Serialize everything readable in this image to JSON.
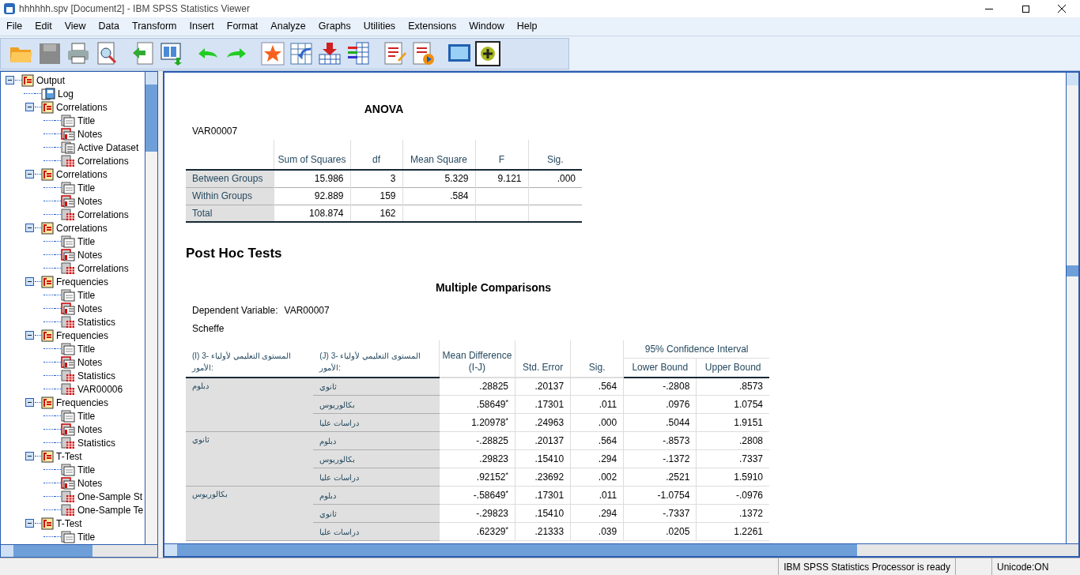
{
  "window": {
    "title": "hhhhhh.spv [Document2] - IBM SPSS Statistics Viewer"
  },
  "menu": [
    "File",
    "Edit",
    "View",
    "Data",
    "Transform",
    "Insert",
    "Format",
    "Analyze",
    "Graphs",
    "Utilities",
    "Extensions",
    "Window",
    "Help"
  ],
  "outline": [
    {
      "label": "Output",
      "kind": "folder",
      "expanded": true,
      "children": [
        {
          "label": "Log",
          "kind": "log"
        },
        {
          "label": "Correlations",
          "kind": "folder",
          "expanded": true,
          "children": [
            {
              "label": "Title",
              "kind": "title"
            },
            {
              "label": "Notes",
              "kind": "notes"
            },
            {
              "label": "Active Dataset",
              "kind": "text"
            },
            {
              "label": "Correlations",
              "kind": "table"
            }
          ]
        },
        {
          "label": "Correlations",
          "kind": "folder",
          "expanded": true,
          "children": [
            {
              "label": "Title",
              "kind": "title"
            },
            {
              "label": "Notes",
              "kind": "notes"
            },
            {
              "label": "Correlations",
              "kind": "table"
            }
          ]
        },
        {
          "label": "Correlations",
          "kind": "folder",
          "expanded": true,
          "children": [
            {
              "label": "Title",
              "kind": "title"
            },
            {
              "label": "Notes",
              "kind": "notes"
            },
            {
              "label": "Correlations",
              "kind": "table"
            }
          ]
        },
        {
          "label": "Frequencies",
          "kind": "folder",
          "expanded": true,
          "children": [
            {
              "label": "Title",
              "kind": "title"
            },
            {
              "label": "Notes",
              "kind": "notes"
            },
            {
              "label": "Statistics",
              "kind": "table"
            }
          ]
        },
        {
          "label": "Frequencies",
          "kind": "folder",
          "expanded": true,
          "children": [
            {
              "label": "Title",
              "kind": "title"
            },
            {
              "label": "Notes",
              "kind": "notes"
            },
            {
              "label": "Statistics",
              "kind": "table"
            },
            {
              "label": "VAR00006",
              "kind": "table"
            }
          ]
        },
        {
          "label": "Frequencies",
          "kind": "folder",
          "expanded": true,
          "children": [
            {
              "label": "Title",
              "kind": "title"
            },
            {
              "label": "Notes",
              "kind": "notes"
            },
            {
              "label": "Statistics",
              "kind": "table"
            }
          ]
        },
        {
          "label": "T-Test",
          "kind": "folder",
          "expanded": true,
          "children": [
            {
              "label": "Title",
              "kind": "title"
            },
            {
              "label": "Notes",
              "kind": "notes"
            },
            {
              "label": "One-Sample St",
              "kind": "table"
            },
            {
              "label": "One-Sample Te",
              "kind": "table"
            }
          ]
        },
        {
          "label": "T-Test",
          "kind": "folder",
          "expanded": true,
          "children": [
            {
              "label": "Title",
              "kind": "title"
            }
          ]
        }
      ]
    }
  ],
  "anova": {
    "title": "ANOVA",
    "variable": "VAR00007",
    "columns": [
      "Sum of Squares",
      "df",
      "Mean Square",
      "F",
      "Sig."
    ],
    "rows": [
      {
        "label": "Between Groups",
        "cells": [
          "15.986",
          "3",
          "5.329",
          "9.121",
          ".000"
        ]
      },
      {
        "label": "Within Groups",
        "cells": [
          "92.889",
          "159",
          ".584",
          "",
          ""
        ]
      },
      {
        "label": "Total",
        "cells": [
          "108.874",
          "162",
          "",
          "",
          ""
        ]
      }
    ]
  },
  "post_hoc_heading": "Post Hoc Tests",
  "comparisons": {
    "title": "Multiple Comparisons",
    "dependent_label": "Dependent Variable:",
    "dependent_value": "VAR00007",
    "method": "Scheffe",
    "ci_header": "95% Confidence Interval",
    "columns": [
      "(I) 3- المستوى التعليمي لأولياء الأمور:",
      "(J) 3- المستوى التعليمي لأولياء الأمور:",
      "Mean Difference (I-J)",
      "Std. Error",
      "Sig.",
      "Lower Bound",
      "Upper Bound"
    ],
    "groups": [
      {
        "label": "دبلوم",
        "rows": [
          {
            "label": "ثانوي",
            "cells": [
              ".28825",
              ".20137",
              ".564",
              "-.2808",
              ".8573"
            ]
          },
          {
            "label": "بكالوريوس",
            "cells": [
              ".58649$^{*}$",
              ".17301",
              ".011",
              ".0976",
              "1.0754"
            ]
          },
          {
            "label": "دراسات عليا",
            "cells": [
              "1.20978$^{*}$",
              ".24963",
              ".000",
              ".5044",
              "1.9151"
            ]
          }
        ]
      },
      {
        "label": "ثانوي",
        "rows": [
          {
            "label": "دبلوم",
            "cells": [
              "-.28825",
              ".20137",
              ".564",
              "-.8573",
              ".2808"
            ]
          },
          {
            "label": "بكالوريوس",
            "cells": [
              ".29823",
              ".15410",
              ".294",
              "-.1372",
              ".7337"
            ]
          },
          {
            "label": "دراسات عليا",
            "cells": [
              ".92152$^{*}$",
              ".23692",
              ".002",
              ".2521",
              "1.5910"
            ]
          }
        ]
      },
      {
        "label": "بكالوريوس",
        "rows": [
          {
            "label": "دبلوم",
            "cells": [
              "-.58649$^{*}$",
              ".17301",
              ".011",
              "-1.0754",
              "-.0976"
            ]
          },
          {
            "label": "ثانوي",
            "cells": [
              "-.29823",
              ".15410",
              ".294",
              "-.7337",
              ".1372"
            ]
          },
          {
            "label": "دراسات عليا",
            "cells": [
              ".62329$^{*}$",
              ".21333",
              ".039",
              ".0205",
              "1.2261"
            ]
          }
        ]
      }
    ]
  },
  "status_bar": {
    "message": "IBM SPSS Statistics Processor is ready",
    "encoding": "Unicode:ON"
  }
}
